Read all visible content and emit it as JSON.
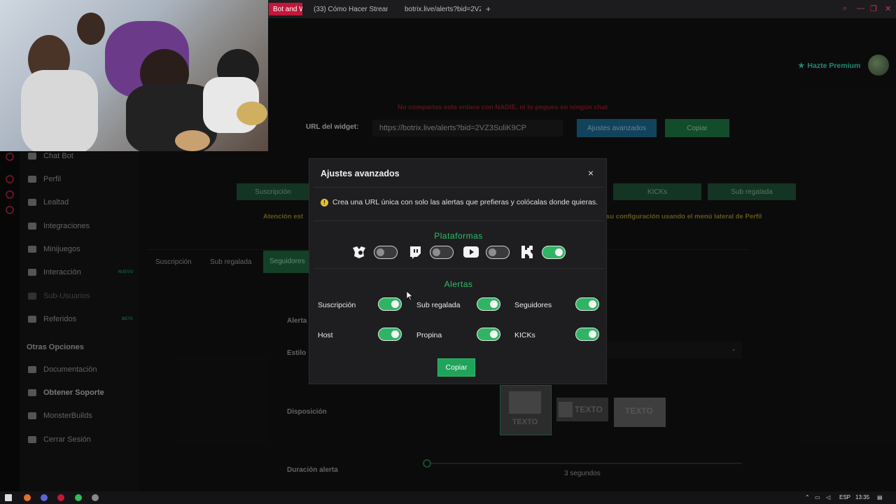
{
  "browser": {
    "tabs": [
      {
        "label": "Bot and Wi"
      },
      {
        "label": "(33) Cómo Hacer Stream"
      },
      {
        "label": "botrix.live/alerts?bid=2VZ"
      }
    ],
    "new_tab": "+"
  },
  "header": {
    "premium_label": "Hazte Premium",
    "warning_text": "No compartas este enlace con NADIE, ni lo pegues en ningún chat",
    "url_label": "URL del widget:",
    "url_value": "https://botrix.live/alerts?bid=2VZ3SuliK9CP",
    "advanced_button": "Ajustes avanzados",
    "copy_button": "Copiar"
  },
  "sidebar": {
    "items": [
      {
        "label": "Chat Bot"
      },
      {
        "label": "Perfil"
      },
      {
        "label": "Lealtad"
      },
      {
        "label": "Integraciones"
      },
      {
        "label": "Minijuegos"
      },
      {
        "label": "Interacción",
        "badge": "NUEVO"
      },
      {
        "label": "Sub-Usuarios"
      },
      {
        "label": "Referidos",
        "badge": "BETA"
      }
    ],
    "section_title": "Otras Opciones",
    "other_items": [
      {
        "label": "Documentación"
      },
      {
        "label": "Obtener Soporte"
      },
      {
        "label": "MonsterBuilds"
      },
      {
        "label": "Cerrar Sesión"
      }
    ]
  },
  "background": {
    "alert_buttons": [
      "Suscripción",
      "KICKs",
      "Sub regalada"
    ],
    "attention_left": "Atención est",
    "attention_right": "su configuración usando el menú lateral de Perfil",
    "tabs": [
      "Suscripción",
      "Sub regalada",
      "Seguidores"
    ],
    "field_alerta": "Alerta",
    "field_estilo": "Estilo",
    "layout_label": "Disposición",
    "layout_text": "TEXTO",
    "duration_label": "Duración alerta",
    "duration_value": "3 segundos"
  },
  "modal": {
    "title": "Ajustes avanzados",
    "close": "×",
    "info": "Crea una URL única con solo las alertas que prefieras y colócalas donde quieras.",
    "platforms_title": "Plataformas",
    "platforms": [
      {
        "name": "botrix",
        "icon": "botrix-icon",
        "enabled": false
      },
      {
        "name": "twitch",
        "icon": "twitch-icon",
        "enabled": false
      },
      {
        "name": "youtube",
        "icon": "youtube-icon",
        "enabled": false
      },
      {
        "name": "kick",
        "icon": "kick-icon",
        "enabled": true
      }
    ],
    "alerts_title": "Alertas",
    "alerts": [
      {
        "label": "Suscripción",
        "enabled": true
      },
      {
        "label": "Sub regalada",
        "enabled": true
      },
      {
        "label": "Seguidores",
        "enabled": true
      },
      {
        "label": "Host",
        "enabled": true
      },
      {
        "label": "Propina",
        "enabled": true
      },
      {
        "label": "KICKs",
        "enabled": true
      }
    ],
    "copy_button": "Copiar"
  },
  "taskbar": {
    "lang": "ESP",
    "time": "13:35"
  },
  "colors": {
    "accent_green": "#2fb463",
    "brand_red": "#c2173a",
    "warning_yellow": "#e6c229"
  }
}
